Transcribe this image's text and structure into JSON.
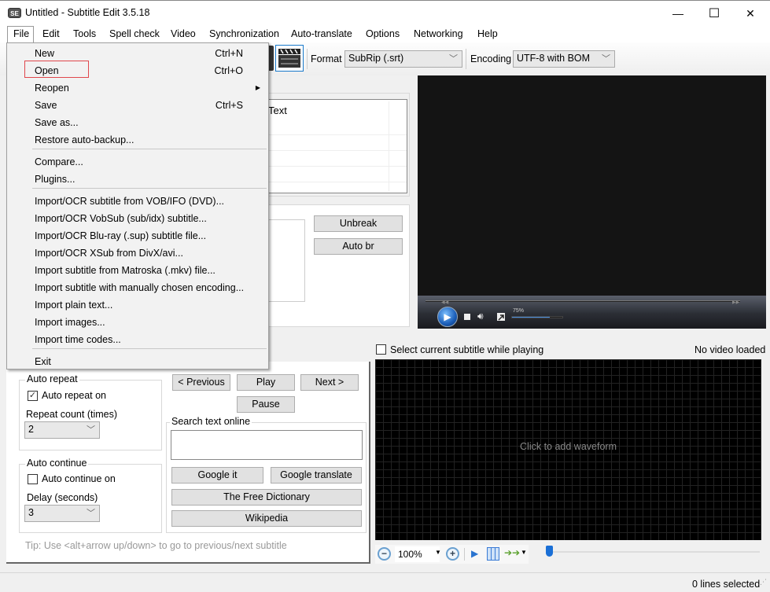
{
  "window": {
    "title": "Untitled - Subtitle Edit 3.5.18",
    "app_icon_text": "SE",
    "minimize": "—",
    "maximize": "☐",
    "close": "✕"
  },
  "menubar": [
    "File",
    "Edit",
    "Tools",
    "Spell check",
    "Video",
    "Synchronization",
    "Auto-translate",
    "Options",
    "Networking",
    "Help"
  ],
  "toolbar": {
    "format_label": "Format",
    "format_value": "SubRip (.srt)",
    "encoding_label": "Encoding",
    "encoding_value": "UTF-8 with BOM"
  },
  "file_menu": {
    "items": [
      {
        "label": "New",
        "shortcut": "Ctrl+N"
      },
      {
        "label": "Open",
        "shortcut": "Ctrl+O",
        "highlighted": true
      },
      {
        "label": "Reopen",
        "submenu": true
      },
      {
        "label": "Save",
        "shortcut": "Ctrl+S"
      },
      {
        "label": "Save as..."
      },
      {
        "label": "Restore auto-backup..."
      },
      {
        "label": "Compare..."
      },
      {
        "label": "Plugins..."
      },
      {
        "label": "Import/OCR subtitle from VOB/IFO (DVD)..."
      },
      {
        "label": "Import/OCR VobSub (sub/idx) subtitle..."
      },
      {
        "label": "Import/OCR Blu-ray (.sup) subtitle file..."
      },
      {
        "label": "Import/OCR XSub from DivX/avi..."
      },
      {
        "label": "Import subtitle from Matroska (.mkv) file..."
      },
      {
        "label": "Import subtitle with manually chosen encoding..."
      },
      {
        "label": "Import plain text..."
      },
      {
        "label": "Import images..."
      },
      {
        "label": "Import time codes..."
      },
      {
        "label": "Exit"
      }
    ],
    "submenu_arrow": "▶"
  },
  "subtitle_list": {
    "column_text": "Text"
  },
  "edit_buttons": {
    "unbreak": "Unbreak",
    "auto_br": "Auto br"
  },
  "video": {
    "volume_label": "75%",
    "volume": 0.75
  },
  "translate_panel": {
    "auto_repeat_title": "Auto repeat",
    "auto_repeat_on": "Auto repeat on",
    "auto_repeat_checked": true,
    "repeat_count_label": "Repeat count (times)",
    "repeat_count_value": "2",
    "auto_continue_title": "Auto continue",
    "auto_continue_on": "Auto continue on",
    "auto_continue_checked": false,
    "delay_label": "Delay (seconds)",
    "delay_value": "3",
    "previous": "< Previous",
    "play": "Play",
    "next": "Next >",
    "pause": "Pause",
    "search_title": "Search text online",
    "google_it": "Google it",
    "google_translate": "Google translate",
    "free_dictionary": "The Free Dictionary",
    "wikipedia": "Wikipedia",
    "tip": "Tip: Use <alt+arrow up/down> to go to previous/next subtitle"
  },
  "waveform": {
    "select_current_label": "Select current subtitle while playing",
    "select_current_checked": false,
    "no_video": "No video loaded",
    "placeholder": "Click to add waveform",
    "zoom_value": "100%"
  },
  "status": {
    "lines_selected": "0 lines selected"
  }
}
